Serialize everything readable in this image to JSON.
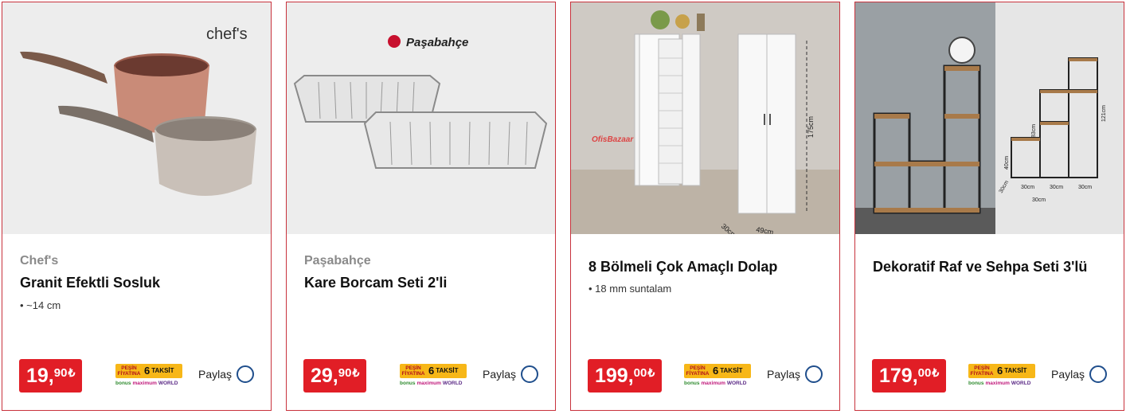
{
  "colors": {
    "accent": "#e11e26",
    "border": "#c8323c",
    "brand_gray": "#8a8a8a"
  },
  "products": [
    {
      "logo_text": "chef's",
      "brand": "Chef's",
      "title": "Granit Efektli Sosluk",
      "features": [
        "• ~14 cm"
      ],
      "price_int": "19,",
      "price_dec": "90",
      "currency": "₺",
      "share_label": "Paylaş"
    },
    {
      "logo_text": "Paşabahçe",
      "brand": "Paşabahçe",
      "title": "Kare Borcam Seti 2'li",
      "features": [],
      "price_int": "29,",
      "price_dec": "90",
      "currency": "₺",
      "share_label": "Paylaş"
    },
    {
      "logo_text": "OfisBazaar",
      "brand": "",
      "title": "8 Bölmeli Çok Amaçlı Dolap",
      "features": [
        "• 18 mm suntalam"
      ],
      "dims": [
        "175cm",
        "49cm",
        "30cm"
      ],
      "price_int": "199,",
      "price_dec": "00",
      "currency": "₺",
      "share_label": "Paylaş"
    },
    {
      "logo_text": "",
      "brand": "",
      "title": "Dekoratif Raf ve Sehpa Seti 3'lü",
      "features": [],
      "dims": [
        "30cm",
        "30cm",
        "30cm",
        "83cm",
        "40cm",
        "30cm",
        "30cm",
        "121cm"
      ],
      "price_int": "179,",
      "price_dec": "00",
      "currency": "₺",
      "share_label": "Paylaş"
    }
  ],
  "taksit_badge": {
    "pesin_line1": "PEŞİN",
    "pesin_line2": "FİYATINA",
    "count": "6",
    "word": "TAKSİT",
    "cards": [
      "bonus",
      "maximum",
      "WORLD"
    ]
  }
}
